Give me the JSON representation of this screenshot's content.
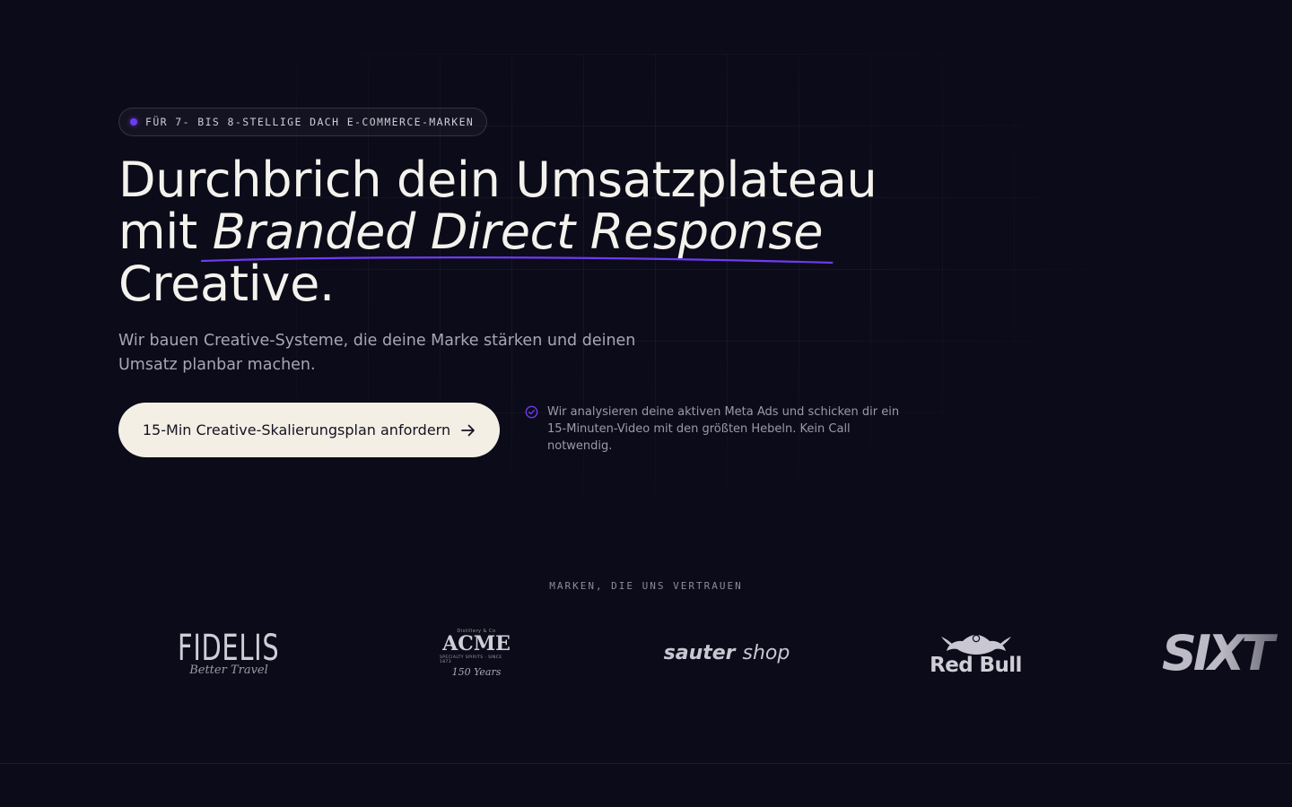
{
  "hero": {
    "badge": "FÜR 7- BIS 8-STELLIGE DACH E-COMMERCE-MARKEN",
    "headline_line1": "Durchbrich dein Umsatzplateau",
    "headline_line2_prefix": "mit ",
    "headline_emphasis": "Branded Direct Response",
    "headline_line3": "Creative.",
    "subtitle": "Wir bauen Creative-Systeme, die deine Marke stärken und deinen Umsatz planbar machen.",
    "cta_label": "15-Min Creative-Skalierungsplan anfordern",
    "note": "Wir analysieren deine aktiven Meta Ads und schicken dir ein 15-Minuten-Video mit den größten Hebeln. Kein Call notwendig."
  },
  "brands": {
    "label": "MARKEN, DIE UNS VERTRAUEN",
    "logos": [
      {
        "name": "FIDELIS",
        "tagline": "Better Travel"
      },
      {
        "name": "ACME",
        "top": "Distillery & Co",
        "sub": "SPECIALTY SPIRITS · SINCE 1873",
        "years": "150 Years"
      },
      {
        "name_bold": "sauter",
        "name_light": "shop"
      },
      {
        "name": "Red Bull"
      },
      {
        "name": "SIXT"
      }
    ]
  },
  "colors": {
    "background": "#0c0b19",
    "accent": "#6d3cf0",
    "cta_background": "#f3efe5"
  },
  "icons": {
    "badge_dot": "dot-icon",
    "cta_arrow": "arrow-right-icon",
    "note_check": "check-circle-icon",
    "redbull_bulls": "bulls-icon"
  }
}
